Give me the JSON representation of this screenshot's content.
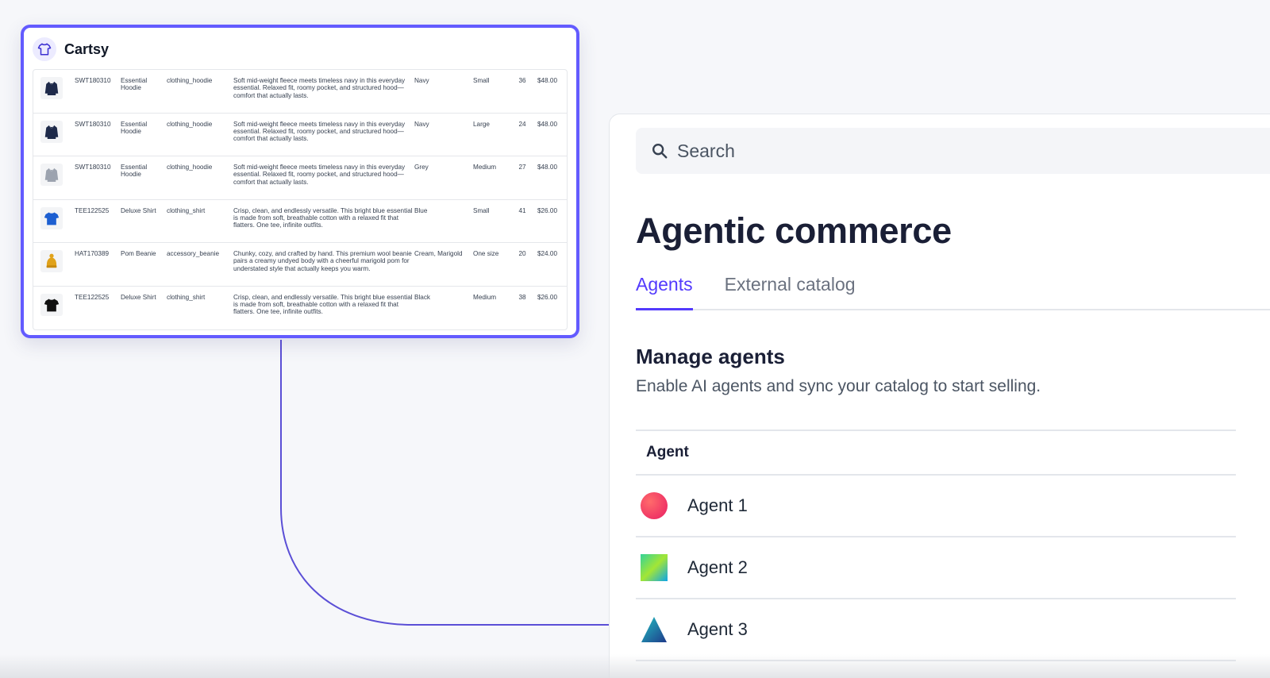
{
  "cartsy": {
    "brand": "Cartsy",
    "products": [
      {
        "sku": "SWT180310",
        "name": "Essential Hoodie",
        "category": "clothing_hoodie",
        "description": "Soft mid-weight fleece meets timeless navy in this everyday essential. Relaxed fit, roomy pocket, and structured hood—comfort that actually lasts.",
        "color": "Navy",
        "size": "Small",
        "qty": "36",
        "price": "$48.00",
        "icon": "hoodie-icon",
        "icon_color": "#1e2a4a"
      },
      {
        "sku": "SWT180310",
        "name": "Essential Hoodie",
        "category": "clothing_hoodie",
        "description": "Soft mid-weight fleece meets timeless navy in this everyday essential. Relaxed fit, roomy pocket, and structured hood—comfort that actually lasts.",
        "color": "Navy",
        "size": "Large",
        "qty": "24",
        "price": "$48.00",
        "icon": "hoodie-icon",
        "icon_color": "#1e2a4a"
      },
      {
        "sku": "SWT180310",
        "name": "Essential Hoodie",
        "category": "clothing_hoodie",
        "description": "Soft mid-weight fleece meets timeless navy in this everyday essential. Relaxed fit, roomy pocket, and structured hood—comfort that actually lasts.",
        "color": "Grey",
        "size": "Medium",
        "qty": "27",
        "price": "$48.00",
        "icon": "hoodie-icon",
        "icon_color": "#9ca3af"
      },
      {
        "sku": "TEE122525",
        "name": "Deluxe Shirt",
        "category": "clothing_shirt",
        "description": "Crisp, clean, and endlessly versatile. This bright blue essential is made from soft, breathable cotton with a relaxed fit that flatters. One tee, infinite outfits.",
        "color": "Blue",
        "size": "Small",
        "qty": "41",
        "price": "$26.00",
        "icon": "tshirt-icon",
        "icon_color": "#1d5fd1"
      },
      {
        "sku": "HAT170389",
        "name": "Pom Beanie",
        "category": "accessory_beanie",
        "description": "Chunky, cozy, and crafted by hand. This premium wool beanie pairs a creamy undyed body with a cheerful marigold pom for understated style that actually keeps you warm.",
        "color": "Cream, Marigold",
        "size": "One size",
        "qty": "20",
        "price": "$24.00",
        "icon": "beanie-icon",
        "icon_color": "#e0a21a"
      },
      {
        "sku": "TEE122525",
        "name": "Deluxe Shirt",
        "category": "clothing_shirt",
        "description": "Crisp, clean, and endlessly versatile. This bright blue essential is made from soft, breathable cotton with a relaxed fit that flatters. One tee, infinite outfits.",
        "color": "Black",
        "size": "Medium",
        "qty": "38",
        "price": "$26.00",
        "icon": "tshirt-icon",
        "icon_color": "#111111"
      }
    ]
  },
  "dashboard": {
    "search_placeholder": "Search",
    "title": "Agentic commerce",
    "tabs": [
      {
        "label": "Agents",
        "active": true
      },
      {
        "label": "External catalog",
        "active": false
      }
    ],
    "section_title": "Manage agents",
    "section_subtitle": "Enable AI agents and sync your catalog to start selling.",
    "table_header": "Agent",
    "agents": [
      {
        "name": "Agent 1",
        "icon": "circle-icon"
      },
      {
        "name": "Agent 2",
        "icon": "square-icon"
      },
      {
        "name": "Agent 3",
        "icon": "triangle-icon"
      }
    ]
  },
  "colors": {
    "accent": "#533afd",
    "card_border": "#635bff",
    "connector": "#5b4fd6"
  }
}
